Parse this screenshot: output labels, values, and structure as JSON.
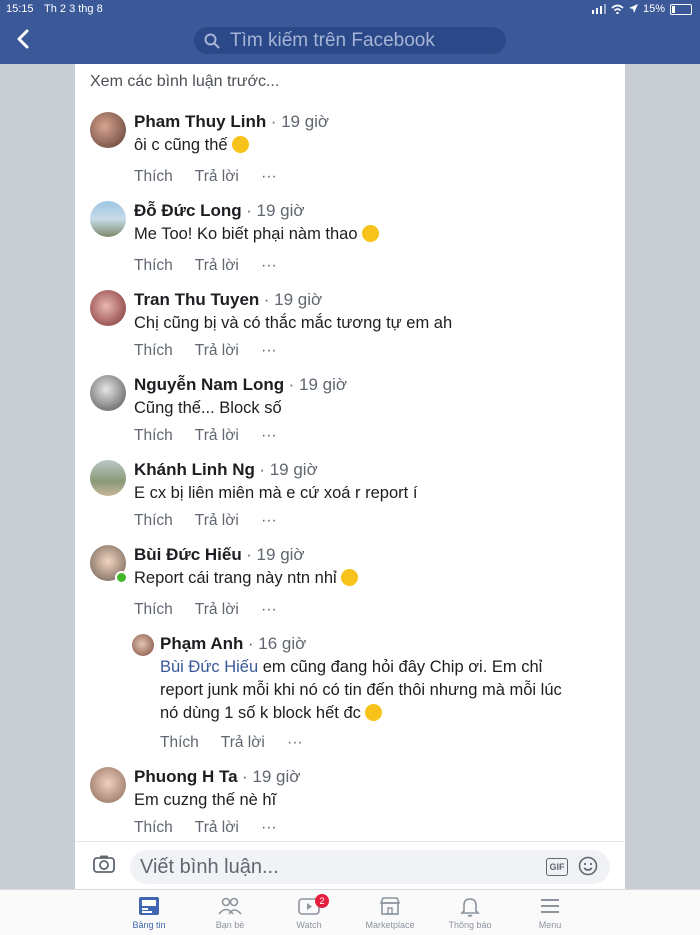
{
  "status": {
    "time": "15:15",
    "date": "Th 2 3 thg 8",
    "battery": "15%"
  },
  "header": {
    "search_placeholder": "Tìm kiếm trên Facebook"
  },
  "see_previous": "Xem các bình luận trước...",
  "actions": {
    "like": "Thích",
    "reply": "Trả lời",
    "more": "···"
  },
  "comments": [
    {
      "name": "Pham Thuy Linh",
      "time": "· 19 giờ",
      "text": "ôi c cũng thế"
    },
    {
      "name": "Đỗ Đức Long",
      "time": "· 19 giờ",
      "text": "Me Too! Ko biết phại nàm thao"
    },
    {
      "name": "Tran Thu Tuyen",
      "time": "· 19 giờ",
      "text": "Chị cũng bị và có thắc mắc tương tự em ah"
    },
    {
      "name": "Nguyễn Nam Long",
      "time": "· 19 giờ",
      "text": "Cũng thế... Block số"
    },
    {
      "name": "Khánh Linh Ng",
      "time": "· 19 giờ",
      "text": "E cx bị liên miên mà e cứ xoá r report í"
    },
    {
      "name": "Bùi Đức Hiếu",
      "time": "· 19 giờ",
      "text": "Report cái trang này ntn nhỉ"
    },
    {
      "name": "Phuong H Ta",
      "time": "· 19 giờ",
      "text": "Em cuzng thế nè hĩ"
    }
  ],
  "reply": {
    "name": "Phạm Anh",
    "time": "· 16 giờ",
    "mention": "Bùi Đức Hiếu",
    "line1": " em cũng đang hỏi đây Chip ơi. Em chỉ",
    "line2": "report junk mỗi khi nó có tin đến thôi nhưng mà mỗi lúc",
    "line3": "nó dùng 1 số k block hết đc"
  },
  "composer": {
    "placeholder": "Viết bình luận...",
    "gif": "GIF"
  },
  "tabbar": {
    "news_feed": "Bảng tin",
    "friends": "Bạn bè",
    "watch": "Watch",
    "watch_badge": "2",
    "marketplace": "Marketplace",
    "notifications": "Thông báo",
    "menu": "Menu"
  },
  "colors": {
    "brand": "#3b5998",
    "link": "#385898",
    "online": "#42b72a",
    "badge": "#e41e3f"
  }
}
